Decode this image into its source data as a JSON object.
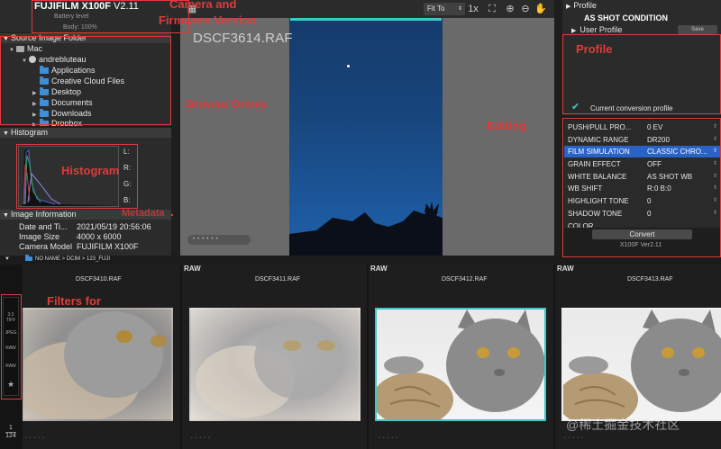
{
  "camera": {
    "model": "FUJIFILM X100F",
    "version": "V2.11",
    "battery": "Battery level",
    "body": "Body: 100%"
  },
  "source_folder": {
    "title": "Source Image Folder",
    "items": [
      {
        "label": "Mac",
        "icon": "drive-icon"
      },
      {
        "label": "andrebluteau",
        "icon": "user-icon"
      },
      {
        "label": "Applications",
        "icon": "folder-icon"
      },
      {
        "label": "Creative Cloud Files",
        "icon": "folder-icon"
      },
      {
        "label": "Desktop",
        "icon": "folder-icon"
      },
      {
        "label": "Documents",
        "icon": "folder-icon"
      },
      {
        "label": "Downloads",
        "icon": "folder-icon"
      },
      {
        "label": "Dropbox",
        "icon": "folder-icon"
      }
    ]
  },
  "histogram": {
    "title": "Histogram",
    "labels": [
      "L:",
      "R:",
      "G:",
      "B:"
    ]
  },
  "image_info": {
    "title": "Image Information",
    "rows": [
      {
        "label": "Date and Ti...",
        "value": "2021/05/19 20:56:06"
      },
      {
        "label": "Image Size",
        "value": "4000 x 6000"
      },
      {
        "label": "Camera Model",
        "value": "FUJIFILM X100F"
      }
    ]
  },
  "toolbar": {
    "fit": "Fit To"
  },
  "preview": {
    "filename": "DSCF3614.RAF"
  },
  "profile": {
    "title": "Profile",
    "as_shot": "AS SHOT CONDITION",
    "user_profile": "User Profile",
    "save": "Save",
    "current": "Current conversion profile"
  },
  "params": [
    {
      "label": "PUSH/PULL PRO...",
      "value": "0 EV",
      "selected": false
    },
    {
      "label": "DYNAMIC RANGE",
      "value": "DR200",
      "selected": false
    },
    {
      "label": "FILM SIMULATION",
      "value": "CLASSIC CHRO...",
      "selected": true
    },
    {
      "label": "GRAIN EFFECT",
      "value": "OFF",
      "selected": false
    },
    {
      "label": "WHITE BALANCE",
      "value": "AS SHOT WB",
      "selected": false
    },
    {
      "label": "WB SHIFT",
      "value": "R:0 B:0",
      "selected": false
    },
    {
      "label": "HIGHLIGHT TONE",
      "value": "0",
      "selected": false
    },
    {
      "label": "SHADOW TONE",
      "value": "0",
      "selected": false
    },
    {
      "label": "COLOR",
      "value": "",
      "selected": false
    }
  ],
  "convert": {
    "label": "Convert",
    "version": "X100F Ver2.11"
  },
  "filmstrip": {
    "path": "NO NAME > DCIM > 123_FUJI",
    "thumbs": [
      {
        "raw": "",
        "name": "DSCF3410.RAF",
        "selected": false
      },
      {
        "raw": "RAW",
        "name": "DSCF3411.RAF",
        "selected": false
      },
      {
        "raw": "RAW",
        "name": "DSCF3412.RAF",
        "selected": true
      },
      {
        "raw": "RAW",
        "name": "DSCF3413.RAF",
        "selected": false
      }
    ],
    "filters": [
      "3:2 TIFF",
      "JPEG",
      "RAW",
      "RAW",
      "★"
    ],
    "page": "1",
    "total": "124"
  },
  "annotations": {
    "camera": "Camera and",
    "firmware": "Firmware Version",
    "browse": "Browse Drives",
    "histogram": "Histogram",
    "editing": "Editing",
    "profile": "Profile",
    "filters": "Filters for",
    "meta": "Metadata"
  },
  "watermark": "@稀土掘金技术社区",
  "colors": {
    "accent": "#3bc8c8",
    "selection": "#2a63c7",
    "annotation": "#e03b3b"
  }
}
